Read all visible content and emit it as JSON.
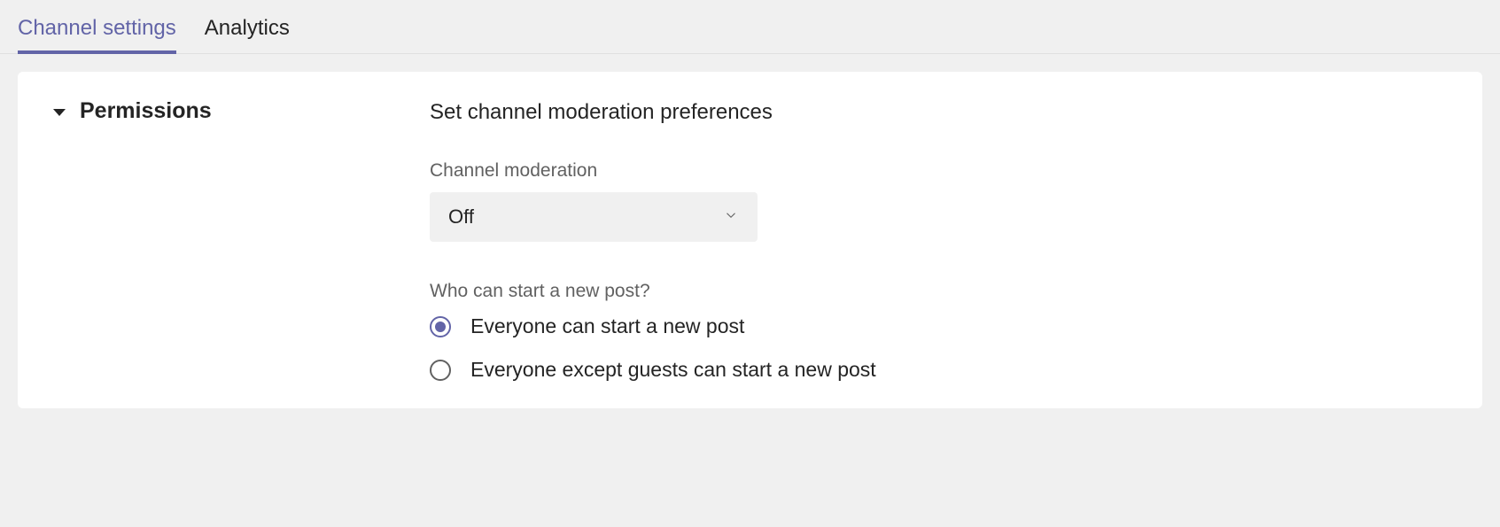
{
  "tabs": {
    "channel_settings": "Channel settings",
    "analytics": "Analytics"
  },
  "permissions": {
    "title": "Permissions",
    "description": "Set channel moderation preferences",
    "moderation": {
      "label": "Channel moderation",
      "value": "Off"
    },
    "who_can_post": {
      "label": "Who can start a new post?",
      "options": {
        "everyone": "Everyone can start a new post",
        "except_guests": "Everyone except guests can start a new post"
      },
      "selected": "everyone"
    }
  }
}
